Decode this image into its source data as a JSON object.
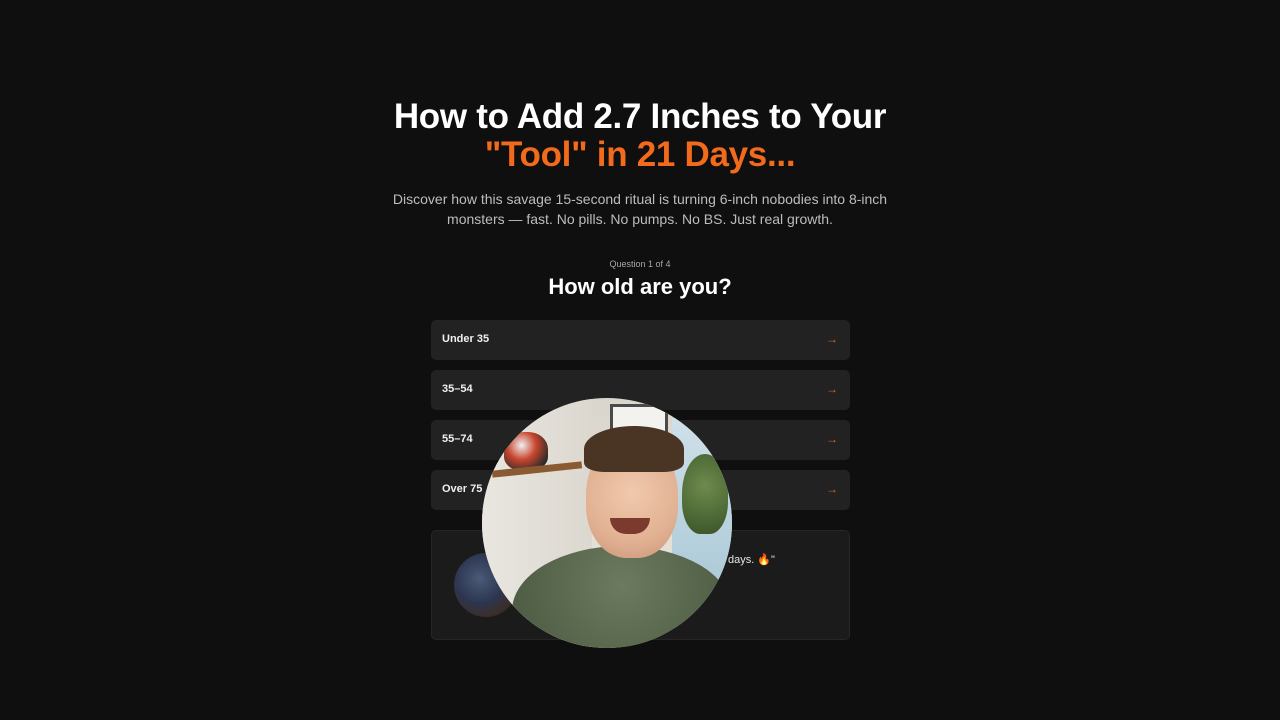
{
  "headline": {
    "line1": "How to Add 2.7 Inches to Your",
    "line2": "\"Tool\" in 21 Days..."
  },
  "subhead": "Discover how this savage 15-second ritual is turning 6-inch nobodies into 8-inch monsters — fast. No pills. No pumps. No BS. Just real growth.",
  "quiz": {
    "counter": "Question 1 of 4",
    "question": "How old are you?",
    "options": [
      {
        "label": "Under 35",
        "arrow": "→"
      },
      {
        "label": "35–54",
        "arrow": "→"
      },
      {
        "label": "55–74",
        "arrow": "→"
      },
      {
        "label": "Over 75",
        "arrow": "→"
      }
    ]
  },
  "testimonial": {
    "quote_fragment": "days. 🔥\""
  },
  "colors": {
    "accent": "#f26a1b",
    "background": "#0f0f0f",
    "option_bg": "#222222"
  },
  "icons": {
    "option_arrow": "arrow-right-icon"
  }
}
